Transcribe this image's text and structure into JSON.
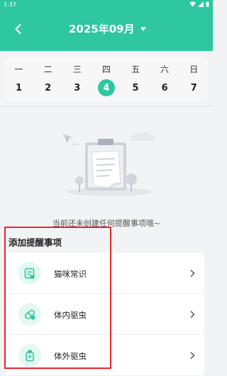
{
  "status_bar": {
    "time": "1:37"
  },
  "header": {
    "title": "2025年09月"
  },
  "calendar": {
    "weekdays": [
      "一",
      "二",
      "三",
      "四",
      "五",
      "六",
      "日"
    ],
    "dates": [
      "1",
      "2",
      "3",
      "4",
      "5",
      "6",
      "7"
    ],
    "selected_date": "4"
  },
  "empty_state": {
    "text": "当前还未创建任何提醒事项哦~"
  },
  "add_section": {
    "title": "添加提醒事项",
    "items": [
      {
        "label": "猫咪常识",
        "icon": "document-icon"
      },
      {
        "label": "体内驱虫",
        "icon": "pill-icon"
      },
      {
        "label": "体外驱虫",
        "icon": "medicine-bottle-icon"
      }
    ]
  },
  "colors": {
    "accent": "#2ec7a0",
    "highlight": "#e8262a"
  }
}
